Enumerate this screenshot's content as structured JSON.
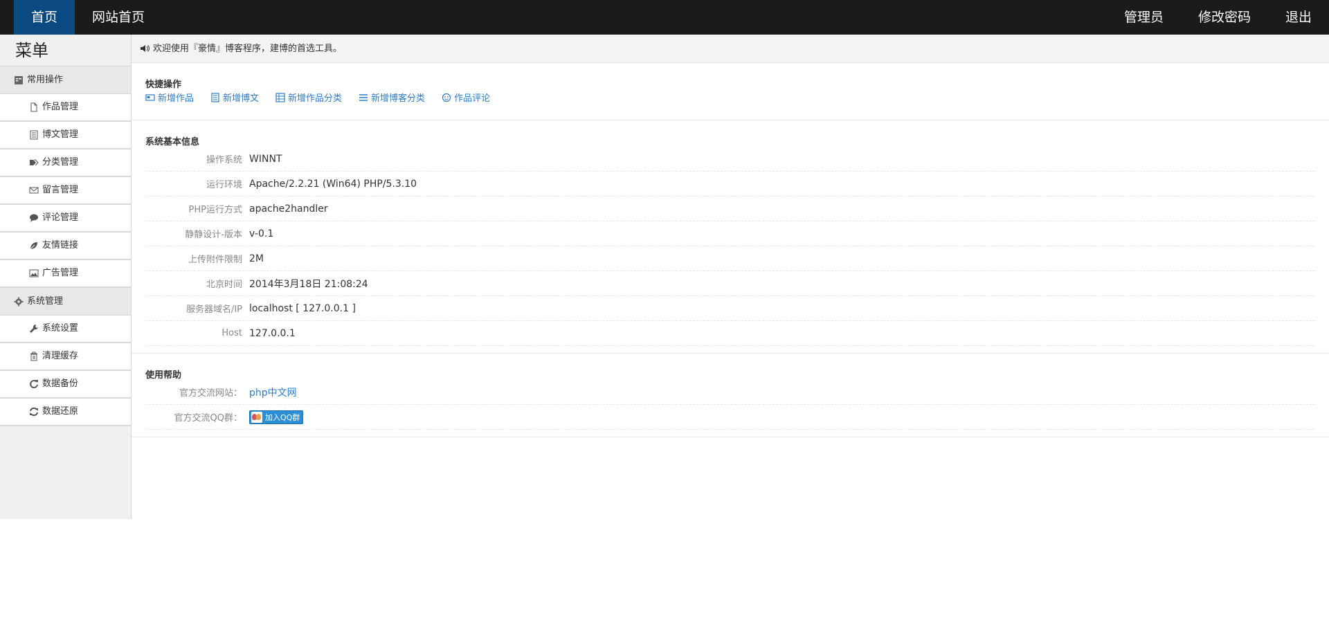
{
  "topnav": {
    "left": [
      "首页",
      "网站首页"
    ],
    "right": [
      "管理员",
      "修改密码",
      "退出"
    ]
  },
  "sidebar": {
    "title": "菜单",
    "groups": [
      {
        "label": "常用操作",
        "icon": "list-icon",
        "items": [
          {
            "label": "作品管理",
            "icon": "file-icon"
          },
          {
            "label": "博文管理",
            "icon": "document-icon"
          },
          {
            "label": "分类管理",
            "icon": "tags-icon"
          },
          {
            "label": "留言管理",
            "icon": "envelope-icon"
          },
          {
            "label": "评论管理",
            "icon": "comment-icon"
          },
          {
            "label": "友情链接",
            "icon": "leaf-icon"
          },
          {
            "label": "广告管理",
            "icon": "image-icon"
          }
        ]
      },
      {
        "label": "系统管理",
        "icon": "gear-icon",
        "items": [
          {
            "label": "系统设置",
            "icon": "wrench-icon"
          },
          {
            "label": "清理缓存",
            "icon": "trash-icon"
          },
          {
            "label": "数据备份",
            "icon": "refresh-icon"
          },
          {
            "label": "数据还原",
            "icon": "sync-icon"
          }
        ]
      }
    ]
  },
  "welcome": {
    "text": "欢迎使用『豪情』博客程序，建博的首选工具。",
    "icon": "speaker-icon"
  },
  "quick": {
    "title": "快捷操作",
    "links": [
      {
        "label": "新增作品",
        "icon": "card-icon"
      },
      {
        "label": "新增博文",
        "icon": "document-icon"
      },
      {
        "label": "新增作品分类",
        "icon": "table-icon"
      },
      {
        "label": "新增博客分类",
        "icon": "lines-icon"
      },
      {
        "label": "作品评论",
        "icon": "smile-icon"
      }
    ]
  },
  "sysinfo": {
    "title": "系统基本信息",
    "rows": [
      {
        "label": "操作系统",
        "value": "WINNT"
      },
      {
        "label": "运行环境",
        "value": "Apache/2.2.21 (Win64) PHP/5.3.10"
      },
      {
        "label": "PHP运行方式",
        "value": "apache2handler"
      },
      {
        "label": "静静设计-版本",
        "value": "v-0.1"
      },
      {
        "label": "上传附件限制",
        "value": "2M"
      },
      {
        "label": "北京时间",
        "value": "2014年3月18日 21:08:24"
      },
      {
        "label": "服务器域名/IP",
        "value": "localhost [ 127.0.0.1 ]"
      },
      {
        "label": "Host",
        "value": "127.0.0.1"
      }
    ]
  },
  "help": {
    "title": "使用帮助",
    "site_label": "官方交流网站：",
    "site_link": "php中文网",
    "qq_label": "官方交流QQ群：",
    "qq_button": "加入QQ群"
  },
  "colors": {
    "topbar": "#1b1b1b",
    "active_tab": "#0b4a80",
    "link": "#2e7bc5"
  }
}
